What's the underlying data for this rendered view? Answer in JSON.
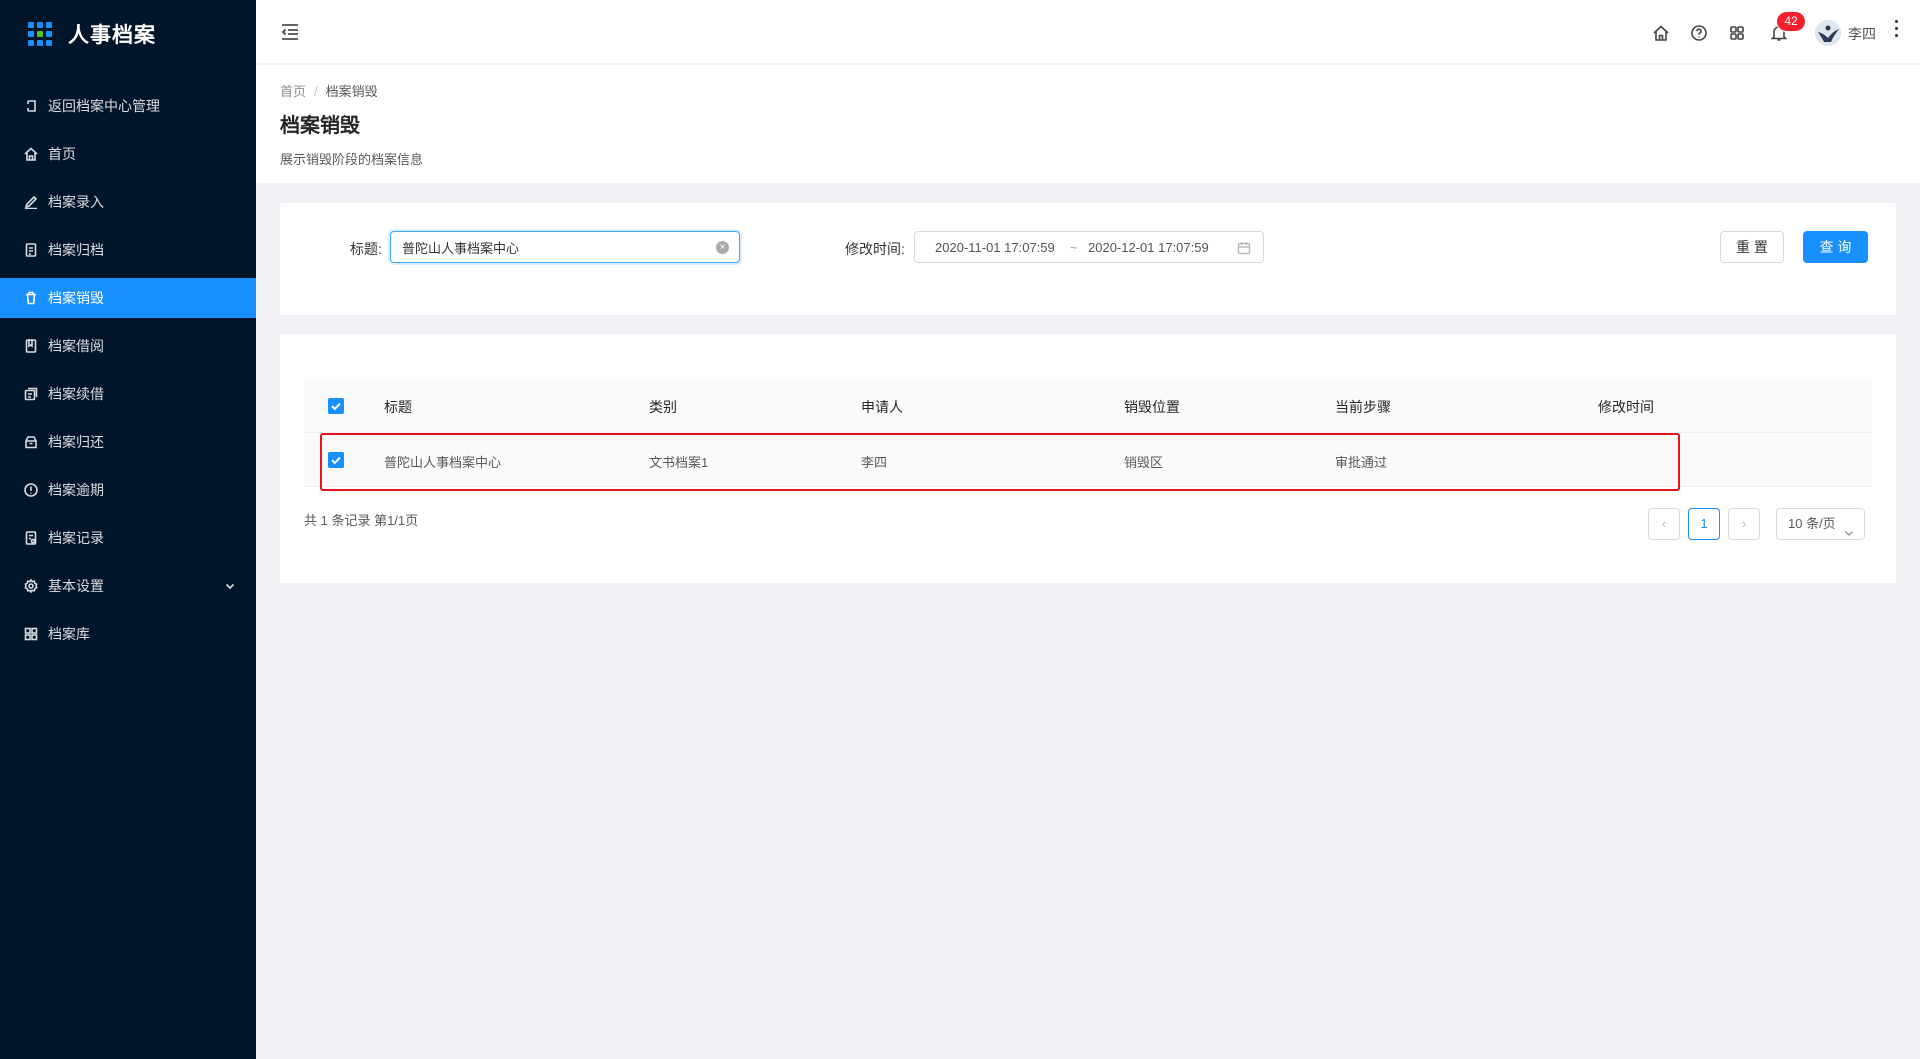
{
  "app": {
    "title": "人事档案"
  },
  "sidebar": {
    "items": [
      {
        "label": "返回档案中心管理",
        "icon": "back-icon"
      },
      {
        "label": "首页",
        "icon": "home-icon"
      },
      {
        "label": "档案录入",
        "icon": "edit-icon"
      },
      {
        "label": "档案归档",
        "icon": "archive-icon"
      },
      {
        "label": "档案销毁",
        "icon": "trash-icon",
        "active": true
      },
      {
        "label": "档案借阅",
        "icon": "book-icon"
      },
      {
        "label": "档案续借",
        "icon": "copy-icon"
      },
      {
        "label": "档案归还",
        "icon": "return-icon"
      },
      {
        "label": "档案逾期",
        "icon": "alert-icon"
      },
      {
        "label": "档案记录",
        "icon": "record-icon"
      },
      {
        "label": "基本设置",
        "icon": "settings-icon",
        "expandable": true
      },
      {
        "label": "档案库",
        "icon": "grid-icon"
      }
    ]
  },
  "header": {
    "notification_count": "42",
    "username": "李四"
  },
  "page": {
    "breadcrumb": [
      "首页",
      "档案销毁"
    ],
    "title": "档案销毁",
    "description": "展示销毁阶段的档案信息"
  },
  "search": {
    "title_label": "标题:",
    "title_value": "普陀山人事档案中心",
    "time_label": "修改时间:",
    "range_start": "2020-11-01 17:07:59",
    "range_separator": "~",
    "range_end": "2020-12-01 17:07:59",
    "reset_label": "重 置",
    "query_label": "查 询"
  },
  "table": {
    "columns": [
      "标题",
      "类别",
      "申请人",
      "销毁位置",
      "当前步骤",
      "修改时间"
    ],
    "rows": [
      {
        "checked": true,
        "cells": [
          "普陀山人事档案中心",
          "文书档案1",
          "李四",
          "销毁区",
          "审批通过",
          ""
        ]
      }
    ],
    "total_text": "共 1 条记录 第1/1页",
    "current_page": "1",
    "page_size": "10 条/页"
  },
  "colors": {
    "sidebar_bg": "#001529",
    "accent": "#1890ff",
    "badge": "#f5222d",
    "highlight_border": "#e8141b"
  }
}
